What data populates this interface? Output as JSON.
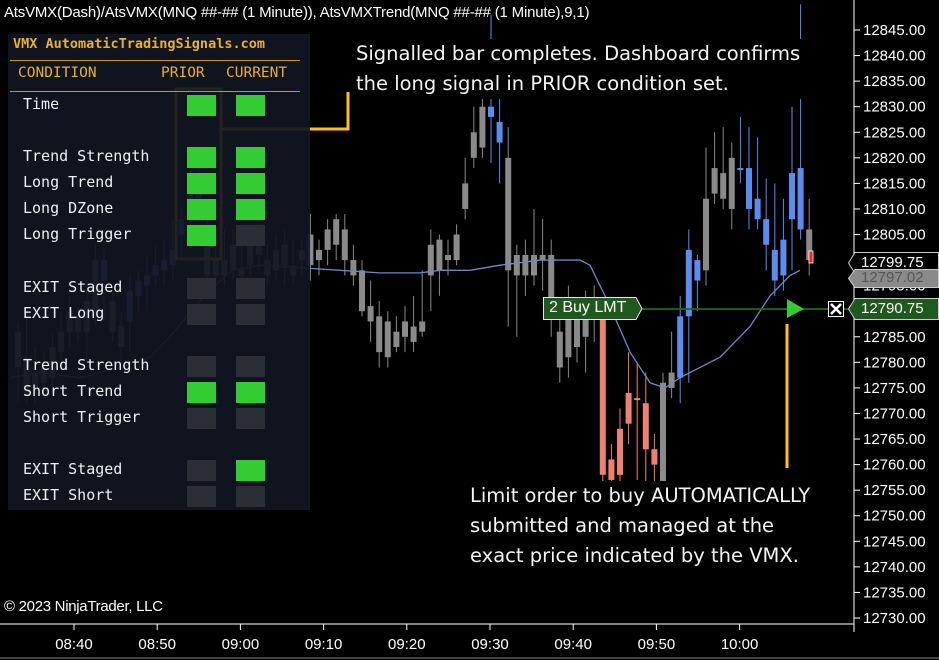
{
  "window": {
    "title": "AtsVMX(Dash)/AtsVMX(MNQ ##-## (1 Minute)), AtsVMXTrend(MNQ ##-## (1 Minute),9,1)",
    "copyright": "© 2023 NinjaTrader, LLC"
  },
  "dashboard": {
    "title": "VMX AutomaticTradingSignals.com",
    "headers": {
      "condition": "CONDITION",
      "prior": "PRIOR",
      "current": "CURRENT"
    },
    "rows": [
      {
        "label": "Time",
        "prior": true,
        "current": true
      },
      {
        "label": "Trend Strength",
        "prior": true,
        "current": true
      },
      {
        "label": "Long Trend",
        "prior": true,
        "current": true
      },
      {
        "label": "Long DZone",
        "prior": true,
        "current": true
      },
      {
        "label": "Long Trigger",
        "prior": true,
        "current": false
      },
      {
        "label": "EXIT Staged",
        "prior": false,
        "current": false
      },
      {
        "label": "EXIT Long",
        "prior": false,
        "current": false
      },
      {
        "label": "Trend Strength",
        "prior": false,
        "current": false
      },
      {
        "label": "Short Trend",
        "prior": true,
        "current": true
      },
      {
        "label": "Short Trigger",
        "prior": false,
        "current": false
      },
      {
        "label": "EXIT Staged",
        "prior": false,
        "current": true
      },
      {
        "label": "EXIT Short",
        "prior": false,
        "current": false
      }
    ],
    "colors": {
      "on": "#33cc33",
      "off": "#2b2e35",
      "accent": "#e8b12a"
    }
  },
  "annotations": {
    "top": "Signalled bar completes. Dashboard confirms the long signal in PRIOR condition set.",
    "top_lines": [
      "Signalled bar completes. Dashboard confirms",
      "the long signal in PRIOR condition set."
    ],
    "bottom_lines": [
      "Limit order to buy AUTOMATICALLY",
      "submitted and managed at the",
      "exact price indicated by the VMX."
    ],
    "highlight_color": "#ffc20e"
  },
  "order": {
    "label": "2 Buy LMT",
    "quantity": 2,
    "side": "Buy",
    "type": "LMT",
    "price": "12790.75",
    "close_icon": "close-x-icon"
  },
  "price_axis": {
    "ticks": [
      "12845.00",
      "12840.00",
      "12835.00",
      "12830.00",
      "12825.00",
      "12820.00",
      "12815.00",
      "12810.00",
      "12805.00",
      "12795.00",
      "12785.00",
      "12780.00",
      "12775.00",
      "12770.00",
      "12765.00",
      "12760.00",
      "12755.00",
      "12750.00",
      "12745.00",
      "12740.00",
      "12735.00",
      "12730.00"
    ],
    "last_price": "12799.75",
    "trend_value": "12797.02",
    "order_price": "12790.75"
  },
  "time_axis": {
    "ticks": [
      "08:40",
      "08:50",
      "09:00",
      "09:10",
      "09:20",
      "09:30",
      "09:40",
      "09:50",
      "10:00"
    ]
  },
  "chart_data": {
    "type": "candlestick",
    "title": "AtsVMX(Dash)/AtsVMX(MNQ ##-## (1 Minute)), AtsVMXTrend(MNQ ##-## (1 Minute),9,1)",
    "ylim": [
      12727,
      12849
    ],
    "x_ticks": [
      "08:40",
      "08:50",
      "09:00",
      "09:10",
      "09:20",
      "09:30",
      "09:40",
      "09:50",
      "10:00"
    ],
    "colors": {
      "neutral": "#8a8a8a",
      "bull": "#5b8def",
      "bear": "#f08070",
      "trend_neutral": "#808080"
    },
    "candles": [
      [
        12786,
        12779,
        12788,
        12772,
        "n"
      ],
      [
        12781,
        12774,
        12790,
        12772,
        "n"
      ],
      [
        12778,
        12775,
        12783,
        12772,
        "n"
      ],
      [
        12779,
        12776,
        12782,
        12773,
        "n"
      ],
      [
        12783,
        12777,
        12786,
        12774,
        "n"
      ],
      [
        12786,
        12782,
        12790,
        12780,
        "n"
      ],
      [
        12790,
        12786,
        12793,
        12783,
        "n"
      ],
      [
        12786,
        12789,
        12791,
        12784,
        "n"
      ],
      [
        12792,
        12786,
        12796,
        12780,
        "n"
      ],
      [
        12800,
        12790,
        12803,
        12787,
        "n"
      ],
      [
        12796,
        12800,
        12802,
        12788,
        "b"
      ],
      [
        12792,
        12786,
        12794,
        12784,
        "n"
      ],
      [
        12787,
        12783,
        12790,
        12780,
        "n"
      ],
      [
        12788,
        12794,
        12797,
        12782,
        "b"
      ],
      [
        12796,
        12793,
        12798,
        12790,
        "b"
      ],
      [
        12797,
        12795,
        12801,
        12790,
        "b"
      ],
      [
        12799,
        12797,
        12803,
        12795,
        "b"
      ],
      [
        12800,
        12798,
        12804,
        12795,
        "b"
      ],
      [
        12802,
        12799,
        12808,
        12796,
        "b"
      ],
      [
        12808,
        12805,
        12810,
        12800,
        "b"
      ],
      [
        12808,
        12815,
        12818,
        12803,
        "b"
      ],
      [
        12815,
        12812,
        12820,
        12810,
        "b"
      ],
      [
        12805,
        12797,
        12808,
        12795,
        "n"
      ],
      [
        12800,
        12797,
        12803,
        12796,
        "n"
      ],
      [
        12800,
        12797,
        12806,
        12795,
        "n"
      ],
      [
        12803,
        12798,
        12806,
        12796,
        "n"
      ],
      [
        12797,
        12798,
        12804,
        12794,
        "n"
      ],
      [
        12799,
        12803,
        12806,
        12797,
        "n"
      ],
      [
        12806,
        12801,
        12807,
        12798,
        "n"
      ],
      [
        12800,
        12797,
        12803,
        12795,
        "n"
      ],
      [
        12802,
        12798,
        12805,
        12796,
        "n"
      ],
      [
        12803,
        12799,
        12806,
        12795,
        "n"
      ],
      [
        12799,
        12797,
        12804,
        12795,
        "n"
      ],
      [
        12800,
        12802,
        12804,
        12797,
        "n"
      ],
      [
        12805,
        12799,
        12809,
        12796,
        "n"
      ],
      [
        12800,
        12802,
        12804,
        12797,
        "n"
      ],
      [
        12802,
        12806,
        12808,
        12799,
        "n"
      ],
      [
        12808,
        12803,
        12809,
        12800,
        "n"
      ],
      [
        12806,
        12800,
        12809,
        12797,
        "n"
      ],
      [
        12800,
        12797,
        12803,
        12795,
        "n"
      ],
      [
        12798,
        12790,
        12800,
        12789,
        "n"
      ],
      [
        12791,
        12788,
        12796,
        12784,
        "n"
      ],
      [
        12789,
        12782,
        12792,
        12779,
        "n"
      ],
      [
        12788,
        12781,
        12790,
        12779,
        "n"
      ],
      [
        12786,
        12783,
        12789,
        12782,
        "n"
      ],
      [
        12788,
        12785,
        12791,
        12782,
        "n"
      ],
      [
        12787,
        12784,
        12793,
        12782,
        "n"
      ],
      [
        12786,
        12788,
        12798,
        12785,
        "n"
      ],
      [
        12797,
        12803,
        12806,
        12790,
        "n"
      ],
      [
        12804,
        12798,
        12805,
        12793,
        "n"
      ],
      [
        12801,
        12800,
        12804,
        12797,
        "n"
      ],
      [
        12805,
        12800,
        12807,
        12799,
        "n"
      ],
      [
        12810,
        12815,
        12820,
        12808,
        "n"
      ],
      [
        12820,
        12825,
        12830,
        12818,
        "n"
      ],
      [
        12830,
        12822,
        12835,
        12820,
        "n"
      ],
      [
        12828,
        12830,
        12848,
        12819,
        "b"
      ],
      [
        12827,
        12823,
        12833,
        12815,
        "b"
      ],
      [
        12820,
        12798,
        12826,
        12787,
        "n"
      ],
      [
        12801,
        12797,
        12803,
        12785,
        "n"
      ],
      [
        12801,
        12797,
        12804,
        12793,
        "n"
      ],
      [
        12801,
        12797,
        12810,
        12795,
        "n"
      ],
      [
        12800,
        12801,
        12808,
        12794,
        "n"
      ],
      [
        12801,
        12790,
        12804,
        12785,
        "n"
      ],
      [
        12786,
        12779,
        12790,
        12776,
        "n"
      ],
      [
        12790,
        12781,
        12795,
        12777,
        "n"
      ],
      [
        12790,
        12783,
        12792,
        12780,
        "n"
      ],
      [
        12790,
        12785,
        12794,
        12778,
        "n"
      ],
      [
        12790,
        12789,
        12795,
        12784,
        "n"
      ],
      [
        12789,
        12758,
        12791,
        12755,
        "r"
      ],
      [
        12761,
        12757,
        12764,
        12755,
        "r"
      ],
      [
        12767,
        12758,
        12771,
        12755,
        "r"
      ],
      [
        12774,
        12768,
        12782,
        12764,
        "r"
      ],
      [
        12773,
        12773,
        12780,
        12757,
        "r"
      ],
      [
        12772,
        12763,
        12778,
        12755,
        "r"
      ],
      [
        12763,
        12760,
        12766,
        12755,
        "r"
      ],
      [
        12776,
        12750,
        12778,
        12745,
        "n"
      ],
      [
        12775,
        12778,
        12786,
        12773,
        "n"
      ],
      [
        12777,
        12789,
        12793,
        12772,
        "b"
      ],
      [
        12789,
        12802,
        12806,
        12776,
        "b"
      ],
      [
        12800,
        12796,
        12801,
        12790,
        "b"
      ],
      [
        12798,
        12812,
        12822,
        12795,
        "n"
      ],
      [
        12813,
        12818,
        12825,
        12811,
        "n"
      ],
      [
        12812,
        12817,
        12826,
        12810,
        "n"
      ],
      [
        12820,
        12810,
        12823,
        12806,
        "n"
      ],
      [
        12818,
        12818,
        12828,
        12815,
        "b"
      ],
      [
        12818,
        12810,
        12826,
        12806,
        "b"
      ],
      [
        12808,
        12812,
        12824,
        12806,
        "b"
      ],
      [
        12808,
        12803,
        12816,
        12798,
        "b"
      ],
      [
        12802,
        12796,
        12815,
        12793,
        "b"
      ],
      [
        12797,
        12804,
        12812,
        12794,
        "b"
      ],
      [
        12817,
        12808,
        12830,
        12798,
        "b"
      ],
      [
        12818,
        12806,
        12850,
        12804,
        "b"
      ],
      [
        12806,
        12800,
        12812,
        12797,
        "n"
      ]
    ],
    "trend_line_note": "VMX trend line rises from ~12777 to ~12799, dips to ~12775 after 09:40, then rises to ~12796"
  }
}
